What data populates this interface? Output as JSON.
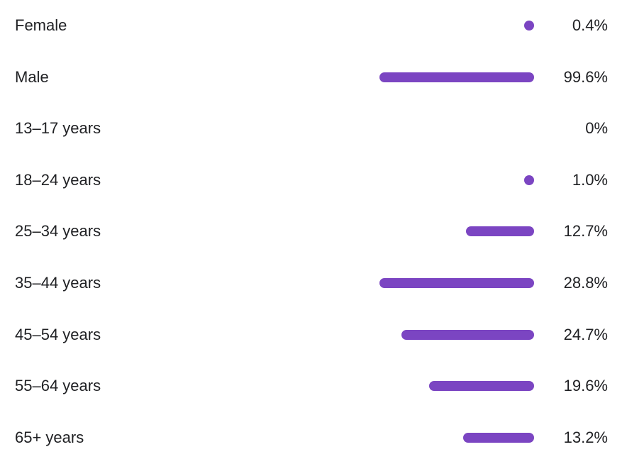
{
  "chart_data": {
    "type": "bar",
    "orientation": "horizontal",
    "categories": [
      "Female",
      "Male",
      "13–17 years",
      "18–24 years",
      "25–34 years",
      "35–44 years",
      "45–54 years",
      "55–64 years",
      "65+ years"
    ],
    "values": [
      0.4,
      99.6,
      0,
      1.0,
      12.7,
      28.8,
      24.7,
      19.6,
      13.2
    ],
    "value_labels": [
      "0.4%",
      "99.6%",
      "0%",
      "1.0%",
      "12.7%",
      "28.8%",
      "24.7%",
      "19.6%",
      "13.2%"
    ],
    "groups": [
      {
        "rows": [
          0,
          1
        ]
      },
      {
        "rows": [
          2,
          3,
          4,
          5,
          6,
          7,
          8
        ]
      }
    ],
    "xlim": [
      0,
      100
    ],
    "bar_color": "#7b45c2",
    "grid": false,
    "legend": "none",
    "title": "",
    "xlabel": "",
    "ylabel": ""
  }
}
